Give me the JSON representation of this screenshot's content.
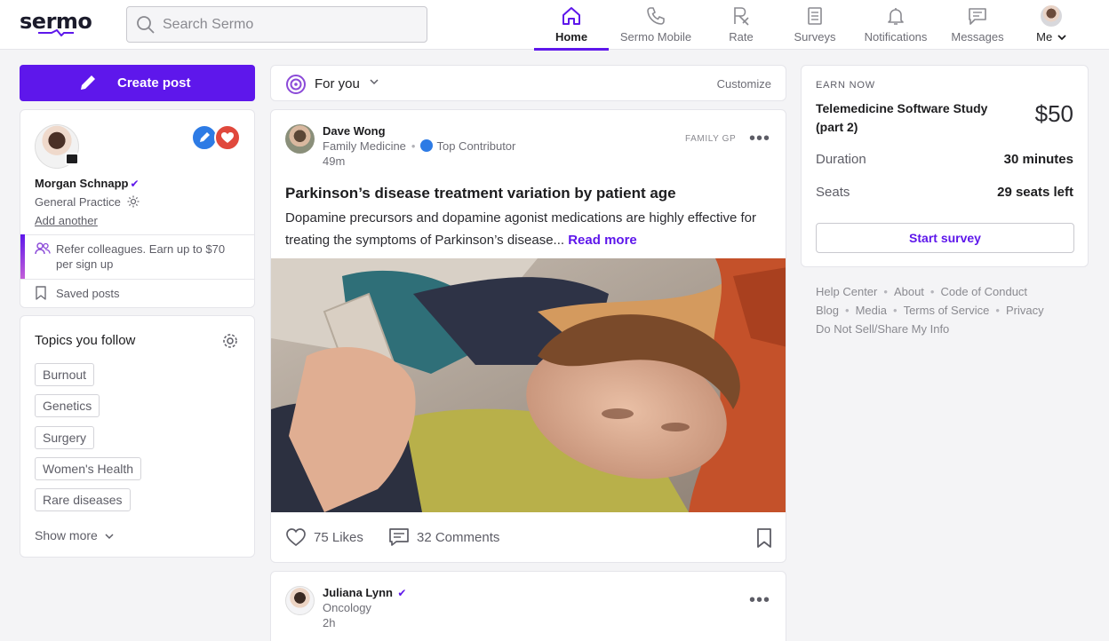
{
  "header": {
    "logo_text": "sermo",
    "search_placeholder": "Search Sermo",
    "nav": [
      {
        "label": "Home",
        "icon": "home-icon",
        "active": true
      },
      {
        "label": "Sermo Mobile",
        "icon": "phone-icon"
      },
      {
        "label": "Rate",
        "icon": "rx-icon"
      },
      {
        "label": "Surveys",
        "icon": "clipboard-icon"
      },
      {
        "label": "Notifications",
        "icon": "bell-icon"
      },
      {
        "label": "Messages",
        "icon": "message-icon"
      },
      {
        "label": "Me",
        "icon": "avatar"
      }
    ]
  },
  "left": {
    "create_post_label": "Create post",
    "profile": {
      "name": "Morgan Schnapp",
      "specialty": "General Practice",
      "add_another": "Add another",
      "refer_text": "Refer colleagues. Earn up to $70 per sign up",
      "saved_posts": "Saved posts"
    },
    "topics": {
      "title": "Topics you follow",
      "items": [
        "Burnout",
        "Genetics",
        "Surgery",
        "Women's Health",
        "Rare diseases"
      ],
      "show_more": "Show more"
    }
  },
  "feed": {
    "filter_label": "For you",
    "customize_label": "Customize",
    "post": {
      "author": "Dave Wong",
      "specialty": "Family Medicine",
      "badge": "Top Contributor",
      "time": "49m",
      "group": "FAMILY GP",
      "title": "Parkinson’s disease treatment variation by patient age",
      "body": "Dopamine precursors and dopamine agonist medications are highly effective for treating the symptoms of Parkinson’s disease...",
      "read_more": "Read more",
      "likes": "75 Likes",
      "comments": "32 Comments"
    },
    "post2": {
      "author": "Juliana Lynn",
      "specialty": "Oncology",
      "time": "2h"
    }
  },
  "right": {
    "earn": {
      "label": "EARN NOW",
      "title": "Telemedicine Software Study (part 2)",
      "amount": "$50",
      "duration_label": "Duration",
      "duration_value": "30 minutes",
      "seats_label": "Seats",
      "seats_value": "29 seats left",
      "button": "Start survey"
    },
    "footer_links": [
      "Help Center",
      "About",
      "Code of Conduct",
      "Blog",
      "Media",
      "Terms of Service",
      "Privacy",
      "Do Not Sell/Share My Info"
    ]
  },
  "colors": {
    "brand": "#5e17eb",
    "background": "#f4f4f6",
    "card": "#ffffff"
  }
}
